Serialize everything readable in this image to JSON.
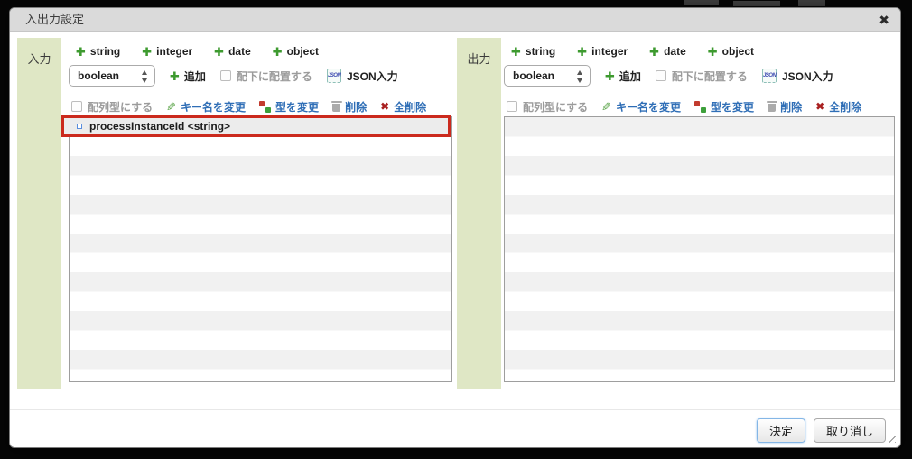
{
  "dialog": {
    "title": "入出力設定"
  },
  "icons": {
    "close": "✖",
    "plus": "✚",
    "pencil": "✎",
    "x": "✖"
  },
  "panels": [
    {
      "label": "入力"
    },
    {
      "label": "出力"
    }
  ],
  "controls": {
    "type_buttons": [
      "string",
      "integer",
      "date",
      "object"
    ],
    "select_value": "boolean",
    "add_label": "追加",
    "nest_label": "配下に配置する",
    "json_icon_text": "JSON",
    "json_label": "JSON入力",
    "array_label": "配列型にする",
    "rename_label": "キー名を変更",
    "retype_label": "型を変更",
    "delete_label": "削除",
    "delete_all_label": "全削除"
  },
  "input_list": {
    "items": [
      {
        "label": "processInstanceId <string>",
        "selected": true
      }
    ]
  },
  "output_list": {
    "items": []
  },
  "footer": {
    "ok_label": "決定",
    "cancel_label": "取り消し"
  },
  "colors": {
    "accent_green": "#3d9a2f",
    "link_blue": "#2f6eb6",
    "selection_red": "#cb2a1d",
    "panel_green": "#dfe7c5",
    "delete_red": "#a92020"
  }
}
